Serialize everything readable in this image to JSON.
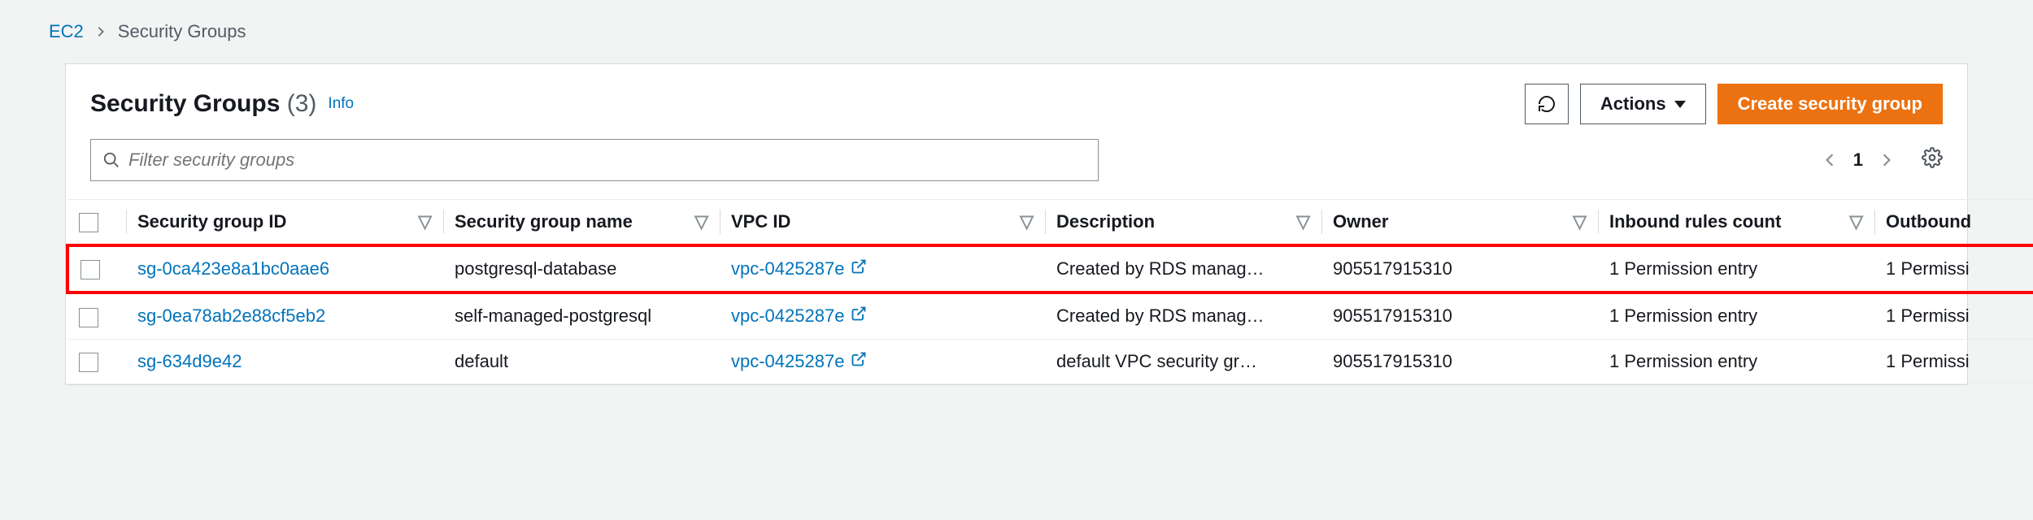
{
  "breadcrumb": {
    "root": "EC2",
    "current": "Security Groups"
  },
  "panel": {
    "title": "Security Groups",
    "count": "(3)",
    "info": "Info"
  },
  "buttons": {
    "actions": "Actions",
    "create": "Create security group"
  },
  "search": {
    "placeholder": "Filter security groups"
  },
  "pager": {
    "page": "1"
  },
  "columns": {
    "sgid": "Security group ID",
    "sgname": "Security group name",
    "vpc": "VPC ID",
    "desc": "Description",
    "owner": "Owner",
    "inbound": "Inbound rules count",
    "outbound": "Outbound"
  },
  "rows": [
    {
      "sgid": "sg-0ca423e8a1bc0aae6",
      "sgname": "postgresql-database",
      "vpc": "vpc-0425287e",
      "desc": "Created by RDS manag…",
      "owner": "905517915310",
      "inbound": "1 Permission entry",
      "outbound": "1 Permissi",
      "highlight": true
    },
    {
      "sgid": "sg-0ea78ab2e88cf5eb2",
      "sgname": "self-managed-postgresql",
      "vpc": "vpc-0425287e",
      "desc": "Created by RDS manag…",
      "owner": "905517915310",
      "inbound": "1 Permission entry",
      "outbound": "1 Permissi"
    },
    {
      "sgid": "sg-634d9e42",
      "sgname": "default",
      "vpc": "vpc-0425287e",
      "desc": "default VPC security gr…",
      "owner": "905517915310",
      "inbound": "1 Permission entry",
      "outbound": "1 Permissi"
    }
  ]
}
